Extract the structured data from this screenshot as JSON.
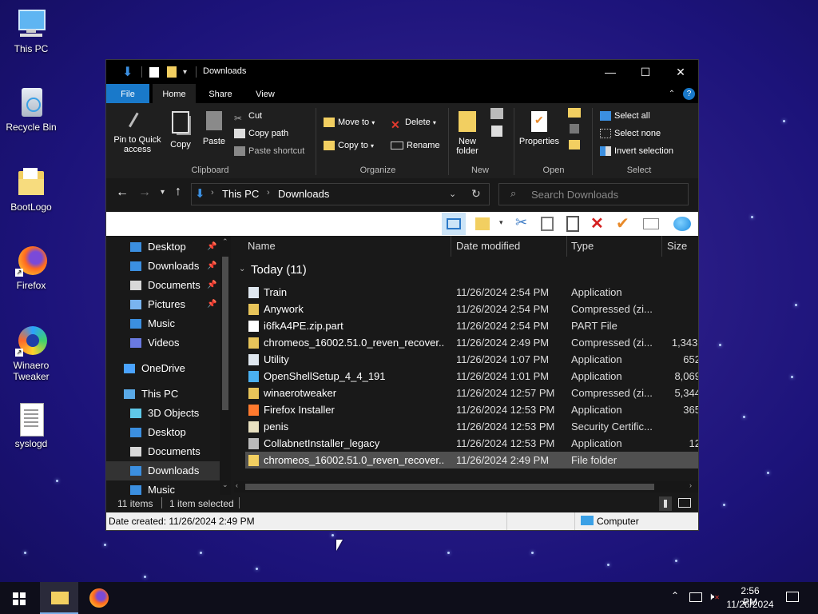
{
  "desktop": {
    "icons": [
      {
        "label": "This PC",
        "icon": "computer-icon"
      },
      {
        "label": "Recycle Bin",
        "icon": "recycle-bin-icon"
      },
      {
        "label": "BootLogo",
        "icon": "folder-icon"
      },
      {
        "label": "Firefox",
        "icon": "firefox-icon"
      },
      {
        "label": "Winaero Tweaker",
        "icon": "winaero-icon"
      },
      {
        "label": "syslogd",
        "icon": "text-file-icon"
      }
    ]
  },
  "window": {
    "title": "Downloads",
    "controls": {
      "minimize": "—",
      "maximize": "☐",
      "close": "✕"
    },
    "tabs": [
      "File",
      "Home",
      "Share",
      "View"
    ],
    "ribbon": {
      "clipboard": {
        "label": "Clipboard",
        "pin": "Pin to Quick access",
        "copy": "Copy",
        "paste": "Paste",
        "cut": "Cut",
        "copy_path": "Copy path",
        "paste_shortcut": "Paste shortcut"
      },
      "organize": {
        "label": "Organize",
        "move_to": "Move to",
        "copy_to": "Copy to",
        "delete": "Delete",
        "rename": "Rename"
      },
      "new": {
        "label": "New",
        "new_folder": "New folder"
      },
      "open": {
        "label": "Open",
        "properties": "Properties"
      },
      "select": {
        "label": "Select",
        "select_all": "Select all",
        "select_none": "Select none",
        "invert": "Invert selection"
      }
    },
    "address": {
      "crumb1": "This PC",
      "crumb2": "Downloads"
    },
    "search": {
      "placeholder": "Search Downloads"
    },
    "nav": [
      {
        "label": "Desktop",
        "pinned": true,
        "color": "#3b8fe0"
      },
      {
        "label": "Downloads",
        "pinned": true,
        "color": "#3b8fe0"
      },
      {
        "label": "Documents",
        "pinned": true,
        "color": "#d8d8d8"
      },
      {
        "label": "Pictures",
        "pinned": true,
        "color": "#79b4f0"
      },
      {
        "label": "Music",
        "pinned": false,
        "color": "#3b8fe0"
      },
      {
        "label": "Videos",
        "pinned": false,
        "color": "#6a7ae0"
      },
      {
        "label": "OneDrive",
        "pinned": false,
        "color": "#4aa3ff"
      },
      {
        "label": "This PC",
        "pinned": false,
        "color": "#5aa9e6"
      },
      {
        "label": "3D Objects",
        "pinned": false,
        "color": "#5fc8e8"
      },
      {
        "label": "Desktop",
        "pinned": false,
        "color": "#3b8fe0"
      },
      {
        "label": "Documents",
        "pinned": false,
        "color": "#d8d8d8"
      },
      {
        "label": "Downloads",
        "pinned": false,
        "color": "#3b8fe0"
      },
      {
        "label": "Music",
        "pinned": false,
        "color": "#3b8fe0"
      }
    ],
    "columns": {
      "name": "Name",
      "date": "Date modified",
      "type": "Type",
      "size": "Size"
    },
    "group": "Today (11)",
    "files": [
      {
        "name": "Train",
        "date": "11/26/2024 2:54 PM",
        "type": "Application",
        "size": "",
        "icon": "app-icon"
      },
      {
        "name": "Anywork",
        "date": "11/26/2024 2:54 PM",
        "type": "Compressed (zi...",
        "size": "",
        "icon": "zip-icon"
      },
      {
        "name": "i6fkA4PE.zip.part",
        "date": "11/26/2024 2:54 PM",
        "type": "PART File",
        "size": "",
        "icon": "file-icon"
      },
      {
        "name": "chromeos_16002.51.0_reven_recover...",
        "date": "11/26/2024 2:49 PM",
        "type": "Compressed (zi...",
        "size": "1,343,",
        "icon": "zip-icon"
      },
      {
        "name": "Utility",
        "date": "11/26/2024 1:07 PM",
        "type": "Application",
        "size": "652",
        "icon": "app-icon"
      },
      {
        "name": "OpenShellSetup_4_4_191",
        "date": "11/26/2024 1:01 PM",
        "type": "Application",
        "size": "8,069",
        "icon": "shell-icon"
      },
      {
        "name": "winaerotweaker",
        "date": "11/26/2024 12:57 PM",
        "type": "Compressed (zi...",
        "size": "5,344",
        "icon": "zip-icon"
      },
      {
        "name": "Firefox Installer",
        "date": "11/26/2024 12:53 PM",
        "type": "Application",
        "size": "365",
        "icon": "firefox-icon"
      },
      {
        "name": "penis",
        "date": "11/26/2024 12:53 PM",
        "type": "Security Certific...",
        "size": "",
        "icon": "cert-icon"
      },
      {
        "name": "CollabnetInstaller_legacy",
        "date": "11/26/2024 12:53 PM",
        "type": "Application",
        "size": "12",
        "icon": "installer-icon"
      },
      {
        "name": "chromeos_16002.51.0_reven_recover...",
        "date": "11/26/2024 2:49 PM",
        "type": "File folder",
        "size": "",
        "icon": "folder-icon",
        "selected": true
      }
    ],
    "status": {
      "items": "11 items",
      "selected": "1 item selected"
    },
    "details": {
      "created": "Date created: 11/26/2024 2:49 PM",
      "location": "Computer"
    }
  },
  "taskbar": {
    "time": "2:56 PM",
    "date": "11/26/2024"
  }
}
